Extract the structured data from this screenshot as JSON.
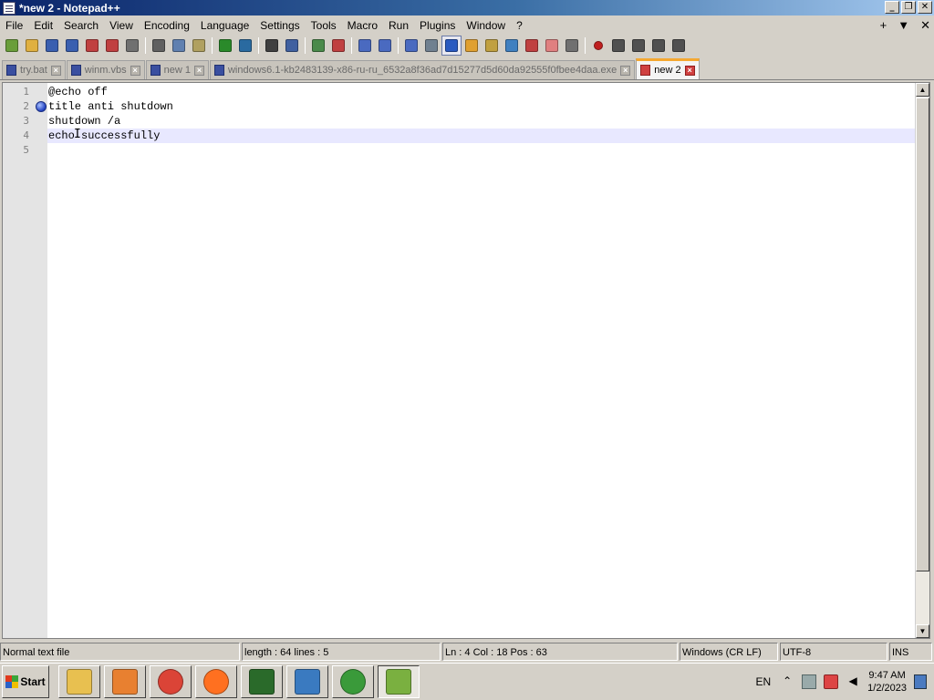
{
  "window": {
    "title": "*new 2 - Notepad++",
    "controls": {
      "minimize": "_",
      "restore": "❐",
      "close": "✕"
    }
  },
  "menu": {
    "items": [
      "File",
      "Edit",
      "Search",
      "View",
      "Encoding",
      "Language",
      "Settings",
      "Tools",
      "Macro",
      "Run",
      "Plugins",
      "Window",
      "?"
    ],
    "right": {
      "add": "+",
      "dropdown": "▼",
      "close": "✕"
    }
  },
  "toolbar": {
    "groups": [
      [
        "new-file-icon",
        "open-file-icon",
        "save-icon",
        "save-all-icon",
        "close-icon",
        "close-all-icon",
        "print-icon"
      ],
      [
        "cut-icon",
        "copy-icon",
        "paste-icon"
      ],
      [
        "undo-icon",
        "redo-icon"
      ],
      [
        "find-icon",
        "replace-icon"
      ],
      [
        "zoom-in-icon",
        "zoom-out-icon"
      ],
      [
        "sync-vertical-icon",
        "sync-horizontal-icon"
      ],
      [
        "word-wrap-icon",
        "show-all-chars-icon",
        "indent-guide-icon",
        "user-language-icon",
        "doc-map-icon",
        "function-list-icon",
        "folder-workspace-icon",
        "monitoring-icon",
        "macro-bubble-icon"
      ],
      [
        "record-macro-icon",
        "stop-macro-icon",
        "play-macro-icon",
        "play-multiple-icon",
        "save-macro-icon"
      ]
    ],
    "active": "indent-guide-icon"
  },
  "tabs": [
    {
      "label": "try.bat",
      "active": false,
      "dirty": false
    },
    {
      "label": "winm.vbs",
      "active": false,
      "dirty": false
    },
    {
      "label": "new 1",
      "active": false,
      "dirty": false
    },
    {
      "label": "windows6.1-kb2483139-x86-ru-ru_6532a8f36ad7d15277d5d60da92555f0fbee4daa.exe",
      "active": false,
      "dirty": false
    },
    {
      "label": "new 2",
      "active": true,
      "dirty": true
    }
  ],
  "editor": {
    "lines": [
      {
        "num": "1",
        "text": "@echo off",
        "bookmark": false,
        "current": false
      },
      {
        "num": "2",
        "text": "title anti shutdown",
        "bookmark": true,
        "current": false
      },
      {
        "num": "3",
        "text": "shutdown /a",
        "bookmark": false,
        "current": false
      },
      {
        "num": "4",
        "text": "echo successfully",
        "bookmark": false,
        "current": true
      },
      {
        "num": "5",
        "text": "",
        "bookmark": false,
        "current": false
      }
    ]
  },
  "status": {
    "file_type": "Normal text file",
    "length": "length : 64   lines : 5",
    "position": "Ln : 4    Col : 18    Pos : 63",
    "eol": "Windows (CR LF)",
    "encoding": "UTF-8",
    "mode": "INS"
  },
  "taskbar": {
    "start_label": "Start",
    "apps": [
      "file-explorer-icon",
      "media-player-icon",
      "chrome-icon",
      "firefox-icon",
      "task-manager-icon",
      "control-panel-icon",
      "network-globe-icon",
      "notepadpp-icon"
    ],
    "active_app": "notepadpp-icon",
    "lang": "EN",
    "time": "9:47 AM",
    "date": "1/2/2023"
  }
}
